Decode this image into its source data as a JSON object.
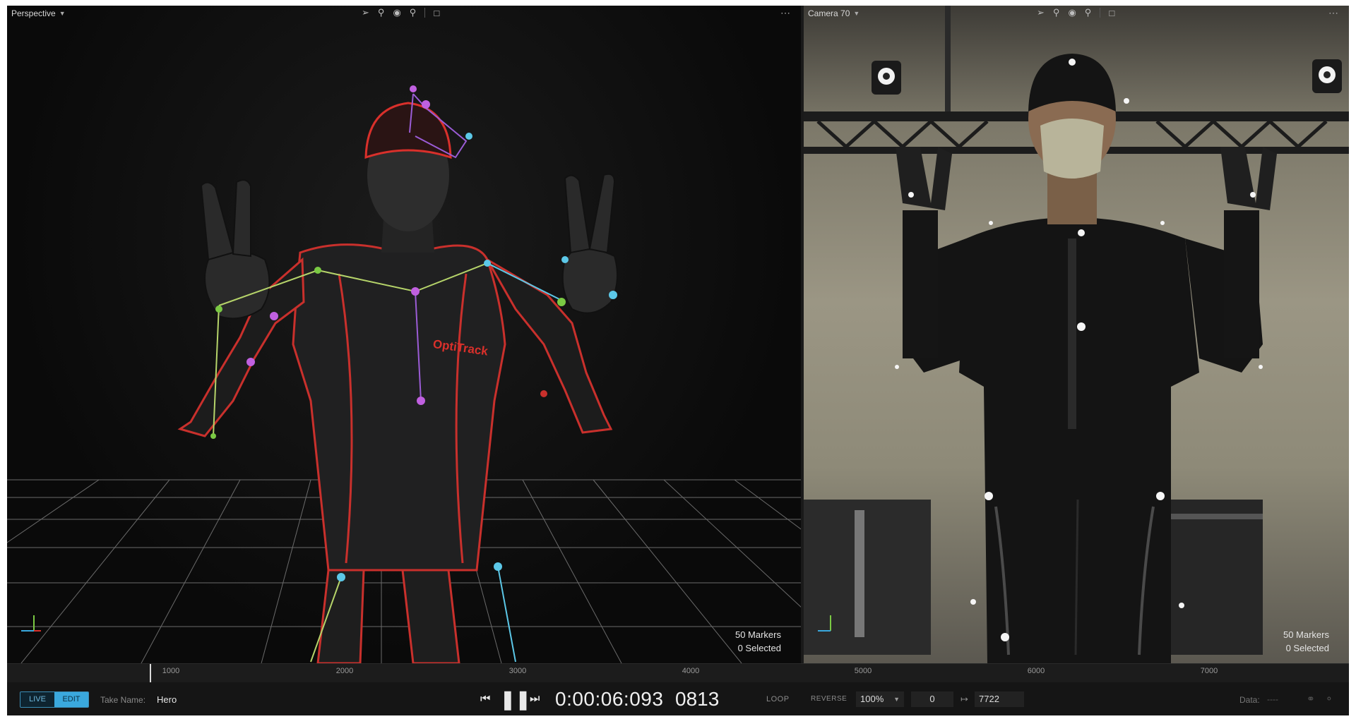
{
  "viewports": {
    "left": {
      "title": "Perspective",
      "markers": "50 Markers",
      "selected": "0 Selected",
      "suit_logo": "OptiTrack"
    },
    "right": {
      "title": "Camera 70",
      "markers": "50 Markers",
      "selected": "0 Selected"
    }
  },
  "toolbar_icons": [
    "select-arrow-icon",
    "zoom-icon",
    "visibility-eye-icon",
    "lasso-icon",
    "frame-box-icon"
  ],
  "timeline": {
    "ticks": [
      "1000",
      "2000",
      "3000",
      "4000",
      "5000",
      "6000",
      "7000"
    ]
  },
  "transport": {
    "mode_live": "LIVE",
    "mode_edit": "EDIT",
    "take_label": "Take Name:",
    "take_name": "Hero",
    "timecode": "0:00:06:093",
    "frame": "0813",
    "loop": "LOOP",
    "reverse": "REVERSE",
    "speed": "100%",
    "range_start": "0",
    "range_end": "7722",
    "data_label": "Data:",
    "data_value": "----"
  },
  "colors": {
    "accent": "#3aa8dd",
    "suit_trim": "#d9302b",
    "marker_purple": "#c060e0",
    "marker_cyan": "#5cc8e8",
    "marker_green": "#7ac943"
  }
}
